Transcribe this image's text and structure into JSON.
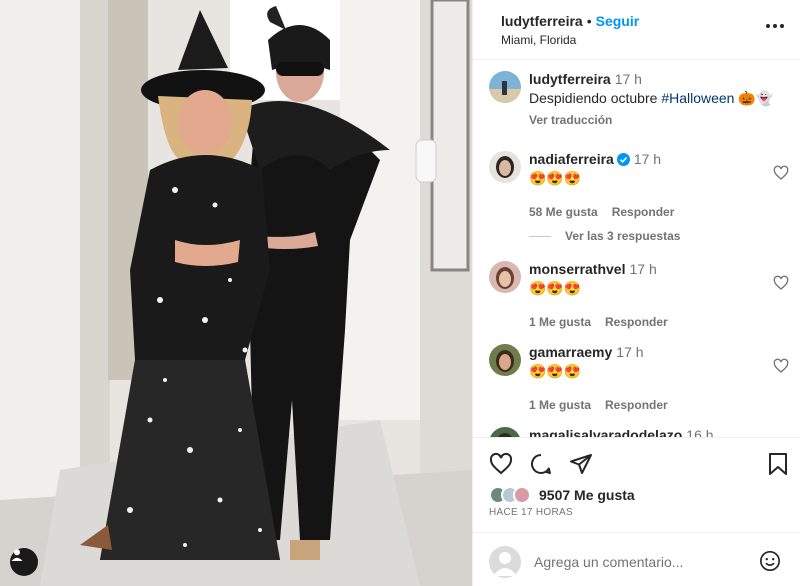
{
  "post": {
    "username": "ludytferreira",
    "follow_label": "Seguir",
    "location": "Miami, Florida",
    "more_icon": "more-horizontal-icon"
  },
  "caption": {
    "username": "ludytferreira",
    "time": "17 h",
    "text": "Despidiendo octubre ",
    "hashtag": "#Halloween",
    "emojis": "🎃👻",
    "translate_label": "Ver traducción"
  },
  "comments": [
    {
      "username": "nadiaferreira",
      "verified": true,
      "time": "17 h",
      "text": "😍😍😍",
      "likes_label": "58 Me gusta",
      "reply_label": "Responder",
      "view_replies": "Ver las 3 respuestas"
    },
    {
      "username": "monserrathvel",
      "time": "17 h",
      "text": "😍😍😍",
      "likes_label": "1 Me gusta",
      "reply_label": "Responder"
    },
    {
      "username": "gamarraemy",
      "time": "17 h",
      "text": "😍😍😍",
      "likes_label": "1 Me gusta",
      "reply_label": "Responder"
    },
    {
      "username": "magalisalvaradodelazo",
      "time": "16 h"
    }
  ],
  "actions": {
    "likes_count": "9507 Me gusta",
    "time_ago": "HACE 17 HORAS"
  },
  "add_comment": {
    "placeholder": "Agrega un comentario..."
  },
  "colors": {
    "accent": "#0095f6",
    "hashtag": "#00376b",
    "muted": "#737373"
  }
}
